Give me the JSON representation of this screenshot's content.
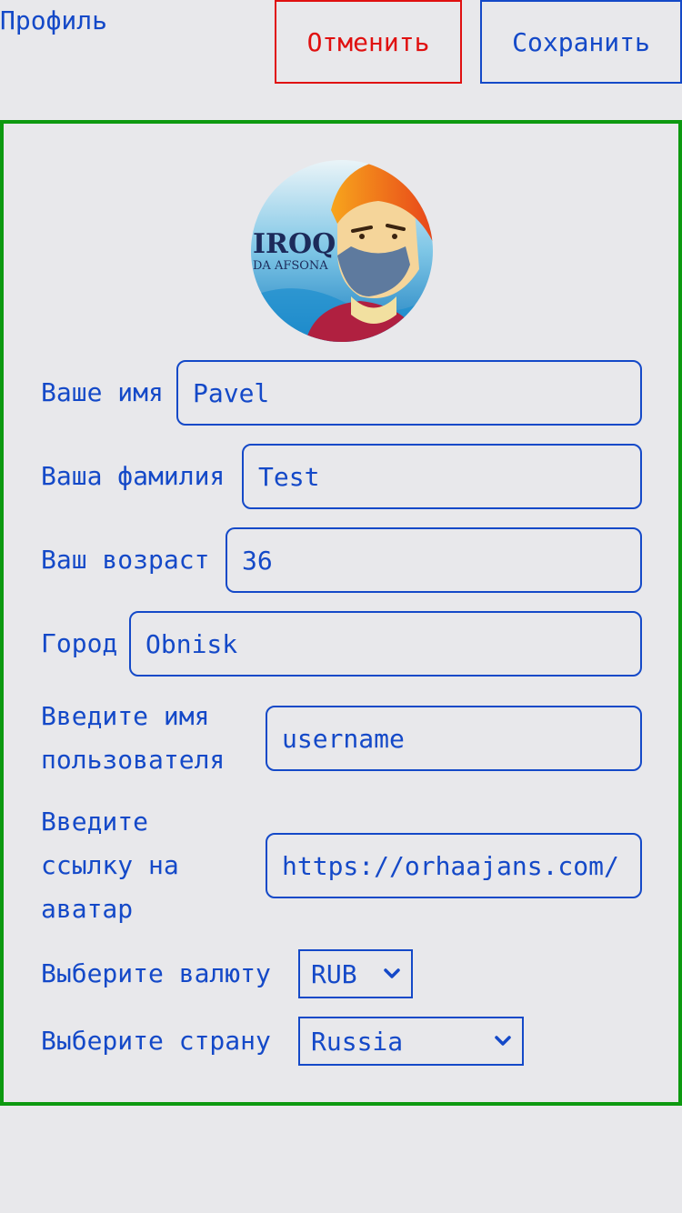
{
  "header": {
    "title": "Профиль",
    "cancel_label": "Отменить",
    "save_label": "Сохранить"
  },
  "colors": {
    "accent": "#1449c8",
    "danger": "#e01010",
    "card_border": "#0d9910",
    "background": "#e8e8eb"
  },
  "form": {
    "first_name": {
      "label": "Ваше имя",
      "value": "Pavel"
    },
    "last_name": {
      "label": "Ваша фамилия",
      "value": "Test"
    },
    "age": {
      "label": "Ваш возраст",
      "value": "36"
    },
    "city": {
      "label": "Город",
      "value": "Obnisk"
    },
    "username": {
      "label_line1": "Введите имя",
      "label_line2": "пользователя",
      "placeholder": "username"
    },
    "avatar_url": {
      "label_line1": "Введите",
      "label_line2": "ссылку на",
      "label_line3": "аватар",
      "value": "https://orhaajans.com/"
    },
    "currency": {
      "label": "Выберите валюту",
      "value": "RUB"
    },
    "country": {
      "label": "Выберите страну",
      "value": "Russia"
    }
  },
  "avatar": {
    "icon": "avatar-image",
    "logo_text_1": "IROQ",
    "logo_text_2": "DA AFSONA"
  }
}
